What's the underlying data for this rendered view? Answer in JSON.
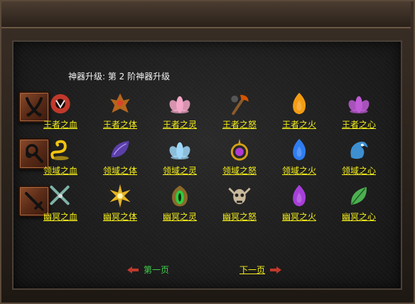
{
  "heading": "神器升级: 第 2 阶神器升级",
  "categories": [
    {
      "icon": "crossed-sabers-icon"
    },
    {
      "icon": "coiled-whip-icon"
    },
    {
      "icon": "crossed-swords-icon"
    }
  ],
  "rows": [
    [
      {
        "label": "王者之血",
        "icon": "red-dark-orb-icon",
        "color": "#c0392b"
      },
      {
        "label": "王者之体",
        "icon": "spiked-crest-icon",
        "color": "#b5651d"
      },
      {
        "label": "王者之灵",
        "icon": "pink-lotus-icon",
        "color": "#f4a7c8"
      },
      {
        "label": "王者之怒",
        "icon": "battle-axe-icon",
        "color": "#d35400"
      },
      {
        "label": "王者之火",
        "icon": "golden-flame-icon",
        "color": "#f39c12"
      },
      {
        "label": "王者之心",
        "icon": "violet-lotus-icon",
        "color": "#c05cd6"
      }
    ],
    [
      {
        "label": "领域之血",
        "icon": "golden-serpent-icon",
        "color": "#f1c40f"
      },
      {
        "label": "领域之体",
        "icon": "purple-shell-icon",
        "color": "#5b3fa8"
      },
      {
        "label": "领域之灵",
        "icon": "blue-lotus-icon",
        "color": "#9ed7f7"
      },
      {
        "label": "领域之怒",
        "icon": "magenta-orb-ring-icon",
        "color": "#b03ad0"
      },
      {
        "label": "领域之火",
        "icon": "blue-flame-icon",
        "color": "#2f7df0"
      },
      {
        "label": "领域之心",
        "icon": "azure-dragon-icon",
        "color": "#3d8fd0"
      }
    ],
    [
      {
        "label": "幽冥之血",
        "icon": "twin-blades-icon",
        "color": "#7fb3a8"
      },
      {
        "label": "幽冥之体",
        "icon": "gold-starburst-icon",
        "color": "#e6b422"
      },
      {
        "label": "幽冥之灵",
        "icon": "green-eye-icon",
        "color": "#2ecc40"
      },
      {
        "label": "幽冥之怒",
        "icon": "horned-skull-icon",
        "color": "#c8b89a"
      },
      {
        "label": "幽冥之火",
        "icon": "purple-crystal-flame-icon",
        "color": "#a63fd8"
      },
      {
        "label": "幽冥之心",
        "icon": "green-leaf-icon",
        "color": "#4caf50"
      }
    ]
  ],
  "nav": {
    "first": "第一页",
    "next": "下一页"
  },
  "colors": {
    "label": "#f5ef1a",
    "nav_first": "#3fd24a",
    "arrow": "#c0392b"
  }
}
